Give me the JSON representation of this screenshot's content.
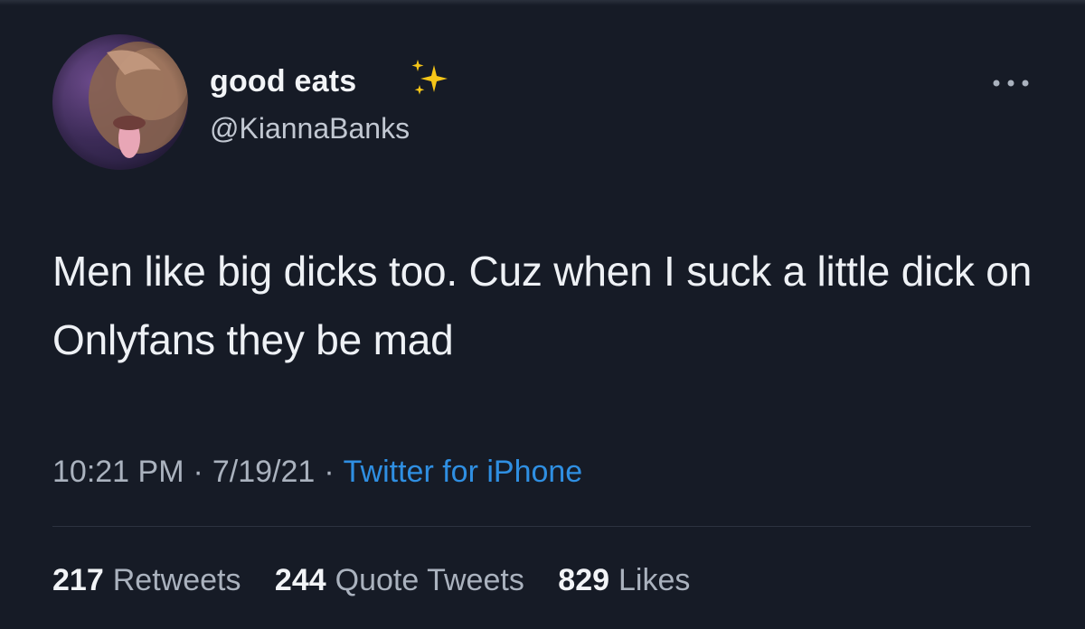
{
  "tweet": {
    "display_name": "good eats",
    "name_emoji": "sparkles-icon",
    "handle": "@KiannaBanks",
    "text": "Men like big dicks too. Cuz when I suck a little dick on Onlyfans they be mad",
    "time": "10:21 PM",
    "date": "7/19/21",
    "separator": "·",
    "source": "Twitter for iPhone",
    "stats": [
      {
        "count": "217",
        "label": "Retweets"
      },
      {
        "count": "244",
        "label": "Quote Tweets"
      },
      {
        "count": "829",
        "label": "Likes"
      }
    ]
  },
  "colors": {
    "background": "#161b26",
    "primary_text": "#eef1f5",
    "secondary_text": "#aab2be",
    "link": "#2f8fe2",
    "sparkle": "#f5c518"
  }
}
